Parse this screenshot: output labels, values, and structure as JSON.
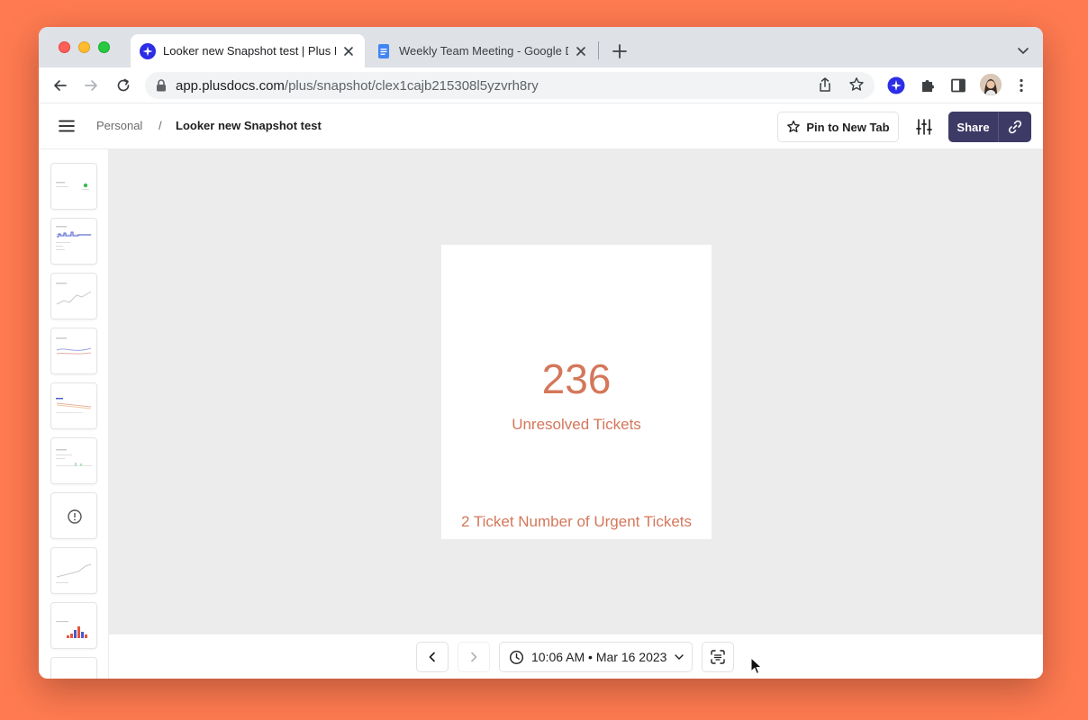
{
  "browser": {
    "tabs": [
      {
        "title": "Looker new Snapshot test | Plus Docs",
        "active": true
      },
      {
        "title": "Weekly Team Meeting - Google Docs",
        "active": false
      }
    ],
    "url_host": "app.plusdocs.com",
    "url_path": "/plus/snapshot/clex1cajb215308l5yzvrh8ry"
  },
  "header": {
    "breadcrumb": {
      "parent": "Personal",
      "separator": "/",
      "current": "Looker new Snapshot test"
    },
    "pin_label": "Pin to New Tab",
    "share_label": "Share"
  },
  "card": {
    "value": "236",
    "label": "Unresolved Tickets",
    "footer": "2 Ticket Number of Urgent Tickets"
  },
  "bottom": {
    "timestamp": "10:06 AM • Mar 16 2023"
  },
  "colors": {
    "accent": "#d4775a",
    "share_bg": "#3e3a66",
    "background": "#ff7a50"
  }
}
